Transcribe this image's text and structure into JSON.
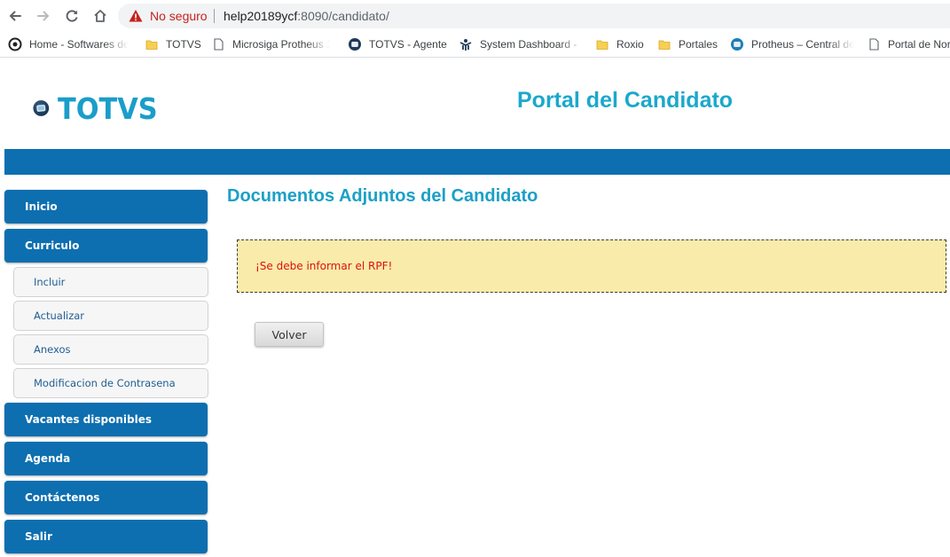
{
  "browser": {
    "not_secure_label": "No seguro",
    "url_host": "help20189ycf",
    "url_rest": ":8090/candidato/",
    "bookmarks": [
      {
        "label": "Home - Softwares de",
        "icon": "globe-icon"
      },
      {
        "label": "TOTVS",
        "icon": "folder-icon"
      },
      {
        "label": "Microsiga Protheus 1",
        "icon": "page-icon"
      },
      {
        "label": "TOTVS - Agente",
        "icon": "totvs-icon"
      },
      {
        "label": "System Dashboard -",
        "icon": "dashboard-icon"
      },
      {
        "label": "Roxio",
        "icon": "folder-icon"
      },
      {
        "label": "Portales",
        "icon": "folder-icon"
      },
      {
        "label": "Protheus – Central de",
        "icon": "totvs-icon"
      },
      {
        "label": "Portal de Nor",
        "icon": "page-icon"
      }
    ]
  },
  "header": {
    "logo_text": "TOTVS",
    "portal_title": "Portal del Candidato"
  },
  "sidebar": {
    "items": [
      {
        "label": "Inicio"
      },
      {
        "label": "Curriculo"
      },
      {
        "label": "Vacantes disponibles"
      },
      {
        "label": "Agenda"
      },
      {
        "label": "Contáctenos"
      },
      {
        "label": "Salir"
      }
    ],
    "subitems": [
      {
        "label": "Incluir"
      },
      {
        "label": "Actualizar"
      },
      {
        "label": "Anexos"
      },
      {
        "label": "Modificacion de Contrasena"
      }
    ]
  },
  "content": {
    "title": "Documentos Adjuntos del Candidato",
    "alert_message": "¡Se debe informar el RPF!",
    "back_button": "Volver"
  },
  "colors": {
    "brand_blue": "#0d6fb0",
    "title_cyan": "#1ba8cc",
    "alert_bg": "#f9ebaa",
    "alert_text": "#dd1111"
  }
}
